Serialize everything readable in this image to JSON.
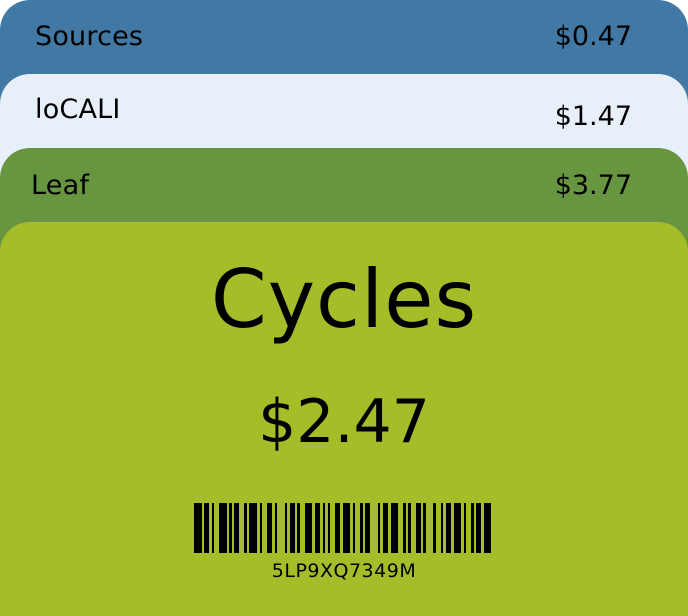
{
  "cards": [
    {
      "name": "Sources",
      "price": "$0.47",
      "color": "#4179a4"
    },
    {
      "name": "loCALI",
      "price": "$1.47",
      "color": "#e7eff8"
    },
    {
      "name": "Leaf",
      "price": "$3.77",
      "color": "#689540"
    }
  ],
  "featured": {
    "name": "Cycles",
    "price": "$2.47",
    "barcode_text": "5LP9XQ7349M",
    "color": "#a5bd28"
  }
}
